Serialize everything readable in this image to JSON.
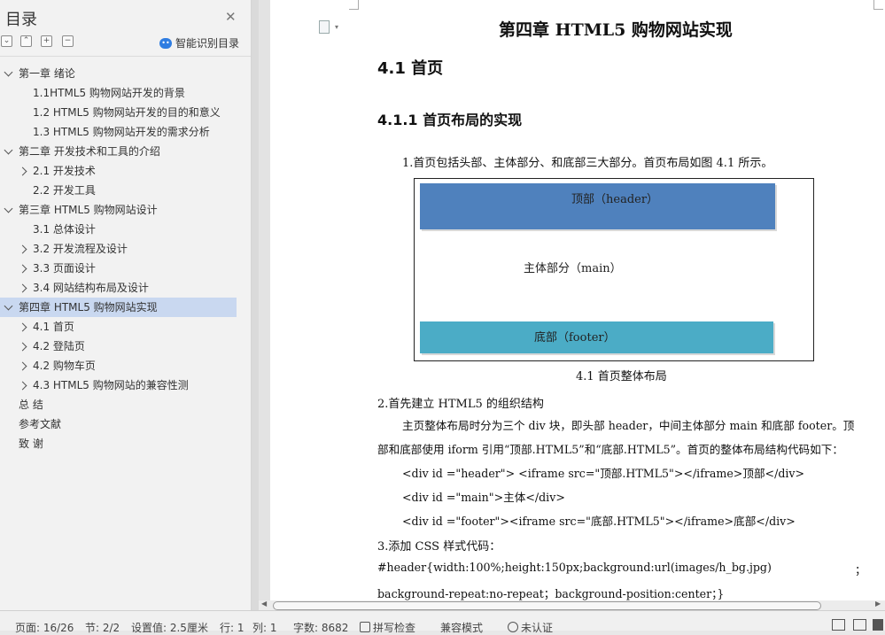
{
  "sidebar": {
    "title": "目录",
    "smart_toc_label": "智能识别目录",
    "toolbar_icons": [
      "collapse-icon",
      "expand-icon",
      "add-icon",
      "remove-icon"
    ],
    "items": [
      {
        "label": "第一章  绪论",
        "level": 1,
        "arrow": "down"
      },
      {
        "label": "1.1HTML5 购物网站开发的背景",
        "level": 2,
        "arrow": "none"
      },
      {
        "label": "1.2 HTML5 购物网站开发的目的和意义",
        "level": 2,
        "arrow": "none"
      },
      {
        "label": "1.3 HTML5 购物网站开发的需求分析",
        "level": 2,
        "arrow": "none"
      },
      {
        "label": "第二章  开发技术和工具的介绍",
        "level": 1,
        "arrow": "down"
      },
      {
        "label": "2.1 开发技术",
        "level": 2,
        "arrow": "right"
      },
      {
        "label": "2.2 开发工具",
        "level": 2,
        "arrow": "none"
      },
      {
        "label": "第三章  HTML5 购物网站设计",
        "level": 1,
        "arrow": "down"
      },
      {
        "label": "3.1 总体设计",
        "level": 2,
        "arrow": "none"
      },
      {
        "label": "3.2 开发流程及设计",
        "level": 2,
        "arrow": "right"
      },
      {
        "label": "3.3 页面设计",
        "level": 2,
        "arrow": "right"
      },
      {
        "label": "3.4 网站结构布局及设计",
        "level": 2,
        "arrow": "right"
      },
      {
        "label": "第四章  HTML5 购物网站实现",
        "level": 1,
        "arrow": "down",
        "selected": true
      },
      {
        "label": "4.1 首页",
        "level": 2,
        "arrow": "right"
      },
      {
        "label": "4.2  登陆页",
        "level": 2,
        "arrow": "right"
      },
      {
        "label": "4.2  购物车页",
        "level": 2,
        "arrow": "right"
      },
      {
        "label": "4.3 HTML5 购物网站的兼容性测",
        "level": 2,
        "arrow": "right"
      },
      {
        "label": "总  结",
        "level": 1,
        "arrow": "none"
      },
      {
        "label": "参考文献",
        "level": 1,
        "arrow": "none"
      },
      {
        "label": "致  谢",
        "level": 1,
        "arrow": "none"
      }
    ]
  },
  "document": {
    "chapter_title": "第四章  HTML5 购物网站实现",
    "section": "4.1 首页",
    "subsection": "4.1.1 首页布局的实现",
    "p1": "1.首页包括头部、主体部分、和底部三大部分。首页布局如图 4.1 所示。",
    "figure": {
      "header_label": "顶部（header）",
      "main_label": "主体部分（main）",
      "footer_label": "底部（footer）",
      "caption": "4.1 首页整体布局",
      "header_color": "#4f81bd",
      "footer_color": "#4bacc6"
    },
    "p2": "2.首先建立 HTML5 的组织结构",
    "p3_line1": "主页整体布局时分为三个 div 块，即头部 header，中间主体部分 main 和底部 footer。顶",
    "p3_line2": "部和底部使用 iform 引用“顶部.HTML5”和“底部.HTML5”。首页的整体布局结构代码如下：",
    "code1": "<div   id =\"header\"> <iframe src=\"顶部.HTML5\"></iframe>顶部</div>",
    "code2": "<div   id =\"main\">主体</div>",
    "code3": "<div   id =\"footer\"><iframe src=\"底部.HTML5\"></iframe>底部</div>",
    "p4": "3.添加 CSS 样式代码：",
    "css1": "#header{width:100%;height:150px;background:url(images/h_bg.jpg)",
    "css1_tail": "；",
    "css2": "background-repeat:no-repeat；background-position:center；}"
  },
  "status_bar": {
    "page": "页面: 16/26",
    "section": "节: 2/2",
    "setting": "设置值: 2.5厘米",
    "row": "行: 1",
    "col": "列: 1",
    "words": "字数: 8682",
    "spell": "拼写检查",
    "compat": "兼容模式",
    "cert": "未认证"
  }
}
